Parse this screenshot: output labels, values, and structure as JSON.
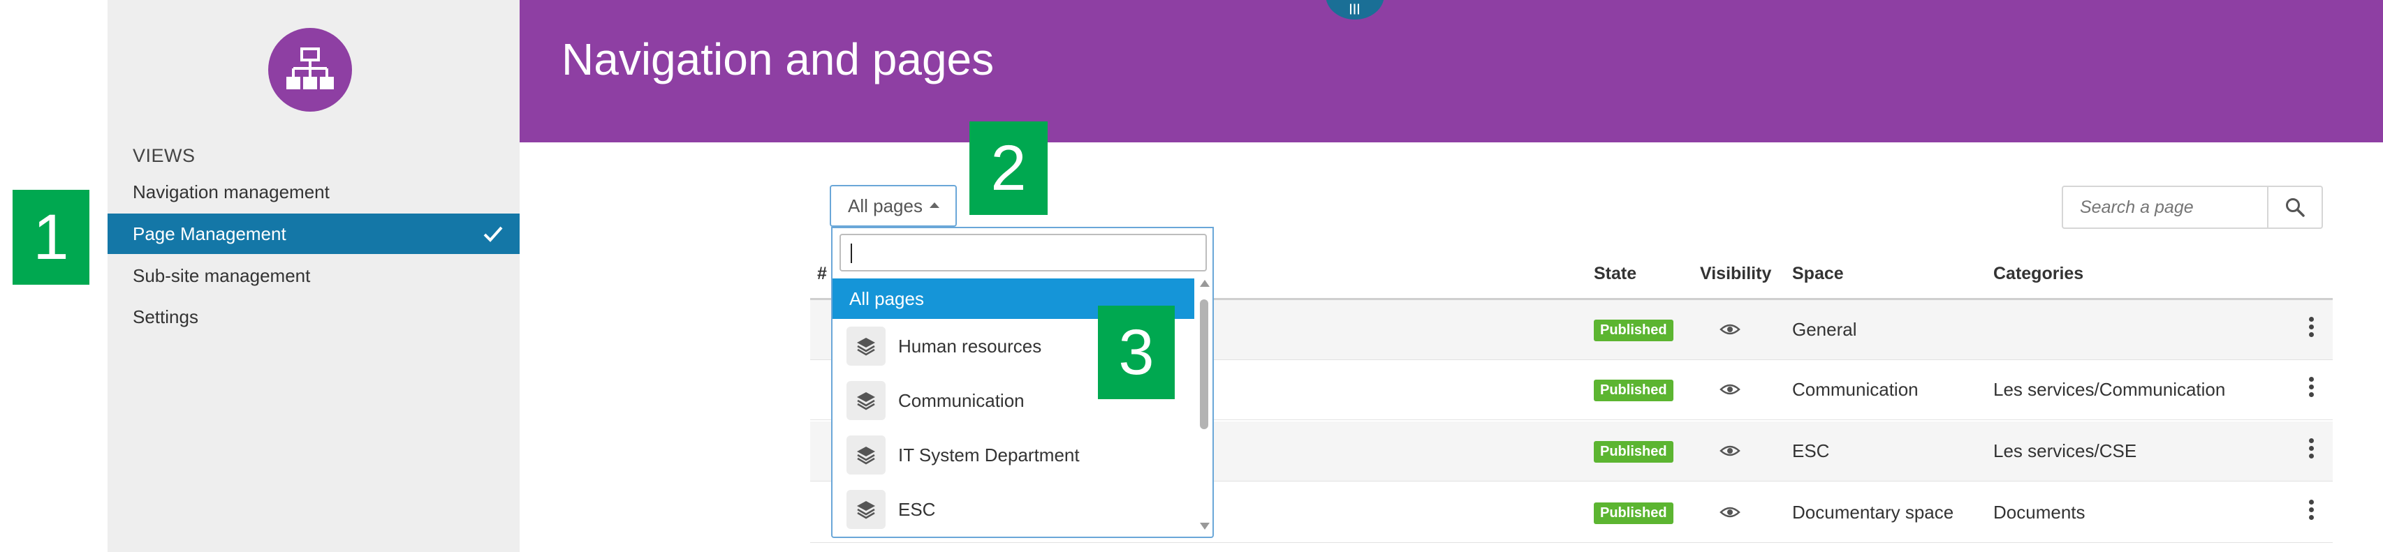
{
  "sidebar": {
    "section_title": "VIEWS",
    "items": [
      {
        "label": "Navigation management",
        "active": false
      },
      {
        "label": "Page Management",
        "active": true
      },
      {
        "label": "Sub-site management",
        "active": false
      },
      {
        "label": "Settings",
        "active": false
      }
    ]
  },
  "header": {
    "title": "Navigation and pages",
    "handle_icon": "menu-lines-icon"
  },
  "callouts": [
    "1",
    "2",
    "3"
  ],
  "filter": {
    "selected_label": "All pages"
  },
  "search": {
    "placeholder": "Search a page"
  },
  "table": {
    "columns": [
      "#",
      "State",
      "Visibility",
      "Space",
      "Categories"
    ],
    "rows": [
      {
        "state": "Published",
        "space": "General",
        "categories": ""
      },
      {
        "state": "Published",
        "space": "Communication",
        "categories": "Les services/Communication"
      },
      {
        "state": "Published",
        "space": "ESC",
        "categories": "Les services/CSE"
      },
      {
        "state": "Published",
        "space": "Documentary space",
        "categories": "Documents"
      }
    ]
  },
  "dropdown": {
    "search_value": "",
    "options": [
      {
        "label": "All pages",
        "icon": "",
        "selected": true
      },
      {
        "label": "Human resources",
        "icon": "layers-icon",
        "selected": false
      },
      {
        "label": "Communication",
        "icon": "layers-icon",
        "selected": false
      },
      {
        "label": "IT System Department",
        "icon": "layers-icon",
        "selected": false
      },
      {
        "label": "ESC",
        "icon": "layers-icon",
        "selected": false
      }
    ]
  },
  "colors": {
    "header_bg": "#8e3fa3",
    "active_item_bg": "#1477a7",
    "selected_option_bg": "#1595d8",
    "callout_bg": "#00a850",
    "published_badge": "#5cb531"
  }
}
